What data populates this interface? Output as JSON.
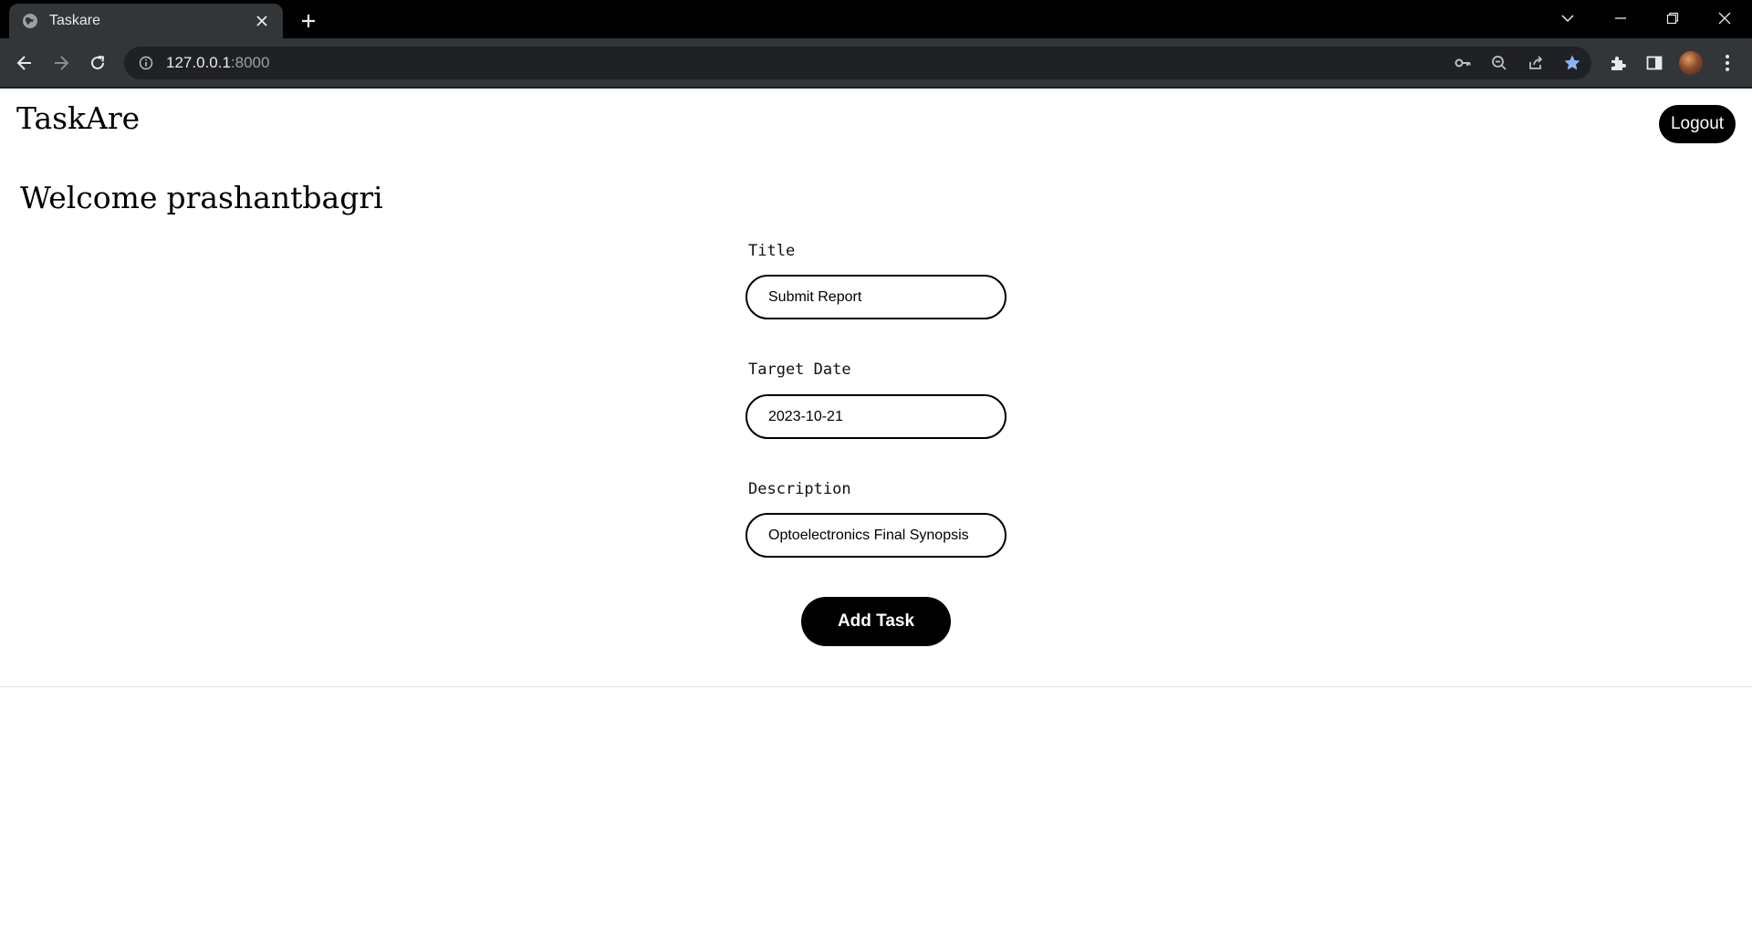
{
  "browser": {
    "tab_title": "Taskare",
    "url_host": "127.0.0.1",
    "url_port": ":8000",
    "accent_color": "#8ab4f8"
  },
  "header": {
    "brand": "TaskAre",
    "logout_label": "Logout"
  },
  "welcome": {
    "prefix": "Welcome",
    "username": "prashantbagri"
  },
  "form": {
    "title_label": "Title",
    "title_value": "Submit Report",
    "date_label": "Target Date",
    "date_value": "2023-10-21",
    "description_label": "Description",
    "description_value": "Optoelectronics Final Synopsis",
    "submit_label": "Add Task"
  }
}
